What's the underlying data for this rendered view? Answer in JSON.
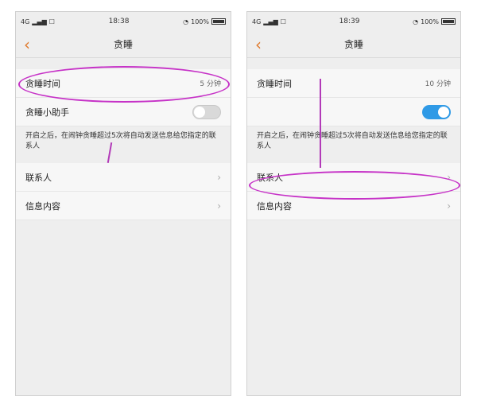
{
  "status_left": {
    "network": "4G",
    "carrier": "☐",
    "time": "18:38",
    "battery": "100%"
  },
  "status_right": {
    "network": "4G",
    "carrier": "☐",
    "time": "18:39",
    "battery": "100%"
  },
  "left": {
    "title": "贪睡",
    "snooze_time_label": "贪睡时间",
    "snooze_time_value": "5 分钟",
    "assistant_label": "贪睡小助手",
    "assistant_toggle": "off",
    "hint": "开启之后，在闹钟贪睡超过5次将自动发送信息给您指定的联系人",
    "contact_label": "联系人",
    "message_label": "信息内容"
  },
  "right": {
    "title": "贪睡",
    "snooze_time_label": "贪睡时间",
    "snooze_time_value": "10 分钟",
    "assistant_toggle": "on",
    "hint": "开启之后，在闹钟贪睡超过5次将自动发送信息给您指定的联系人",
    "contact_label": "联系人",
    "message_label": "信息内容"
  },
  "icons": {
    "back": "chevron-left-icon",
    "wifi": "wifi-icon",
    "chevron": "chevron-right-icon"
  },
  "colors": {
    "accent": "#e07a2c",
    "annotation": "#c632c7",
    "toggle_on": "#2f9ae6"
  }
}
